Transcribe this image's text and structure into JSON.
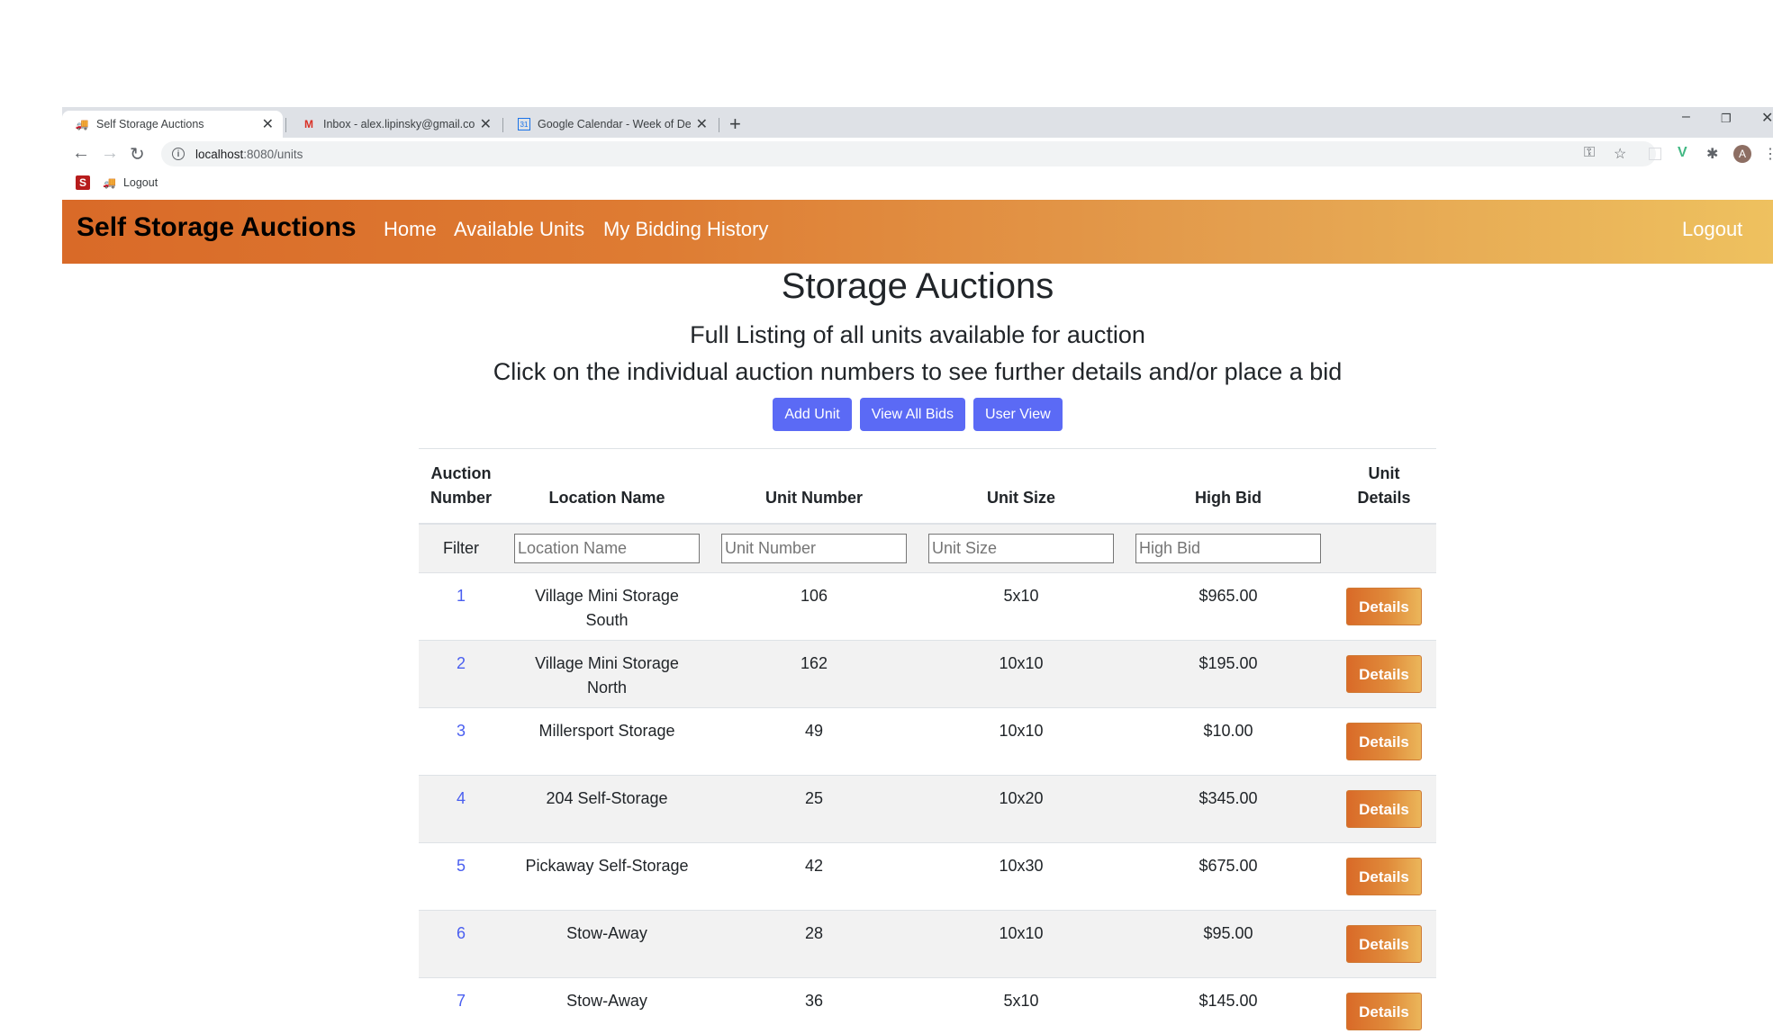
{
  "browser": {
    "tabs": [
      {
        "title": "Self Storage Auctions",
        "active": true
      },
      {
        "title": "Inbox - alex.lipinsky@gmail.com",
        "active": false
      },
      {
        "title": "Google Calendar - Week of Dece",
        "active": false
      }
    ],
    "url_host": "localhost",
    "url_path": ":8080/units",
    "bookmarks": [
      {
        "label": "Logout"
      }
    ],
    "avatar_letter": "A"
  },
  "navbar": {
    "brand": "Self Storage Auctions",
    "links": [
      "Home",
      "Available Units",
      "My Bidding History"
    ],
    "logout": "Logout"
  },
  "main": {
    "title": "Storage Auctions",
    "subtitle1": "Full Listing of all units available for auction",
    "subtitle2": "Click on the individual auction numbers to see further details and/or place a bid",
    "buttons": [
      "Add Unit",
      "View All Bids",
      "User View"
    ]
  },
  "table": {
    "headers": {
      "auction_1": "Auction",
      "auction_2": "Number",
      "location": "Location Name",
      "unit_number": "Unit Number",
      "unit_size": "Unit Size",
      "high_bid": "High Bid",
      "details_1": "Unit",
      "details_2": "Details"
    },
    "filter_label": "Filter",
    "filter_placeholders": {
      "location": "Location Name",
      "unit_number": "Unit Number",
      "unit_size": "Unit Size",
      "high_bid": "High Bid"
    },
    "details_label": "Details",
    "rows": [
      {
        "auction": "1",
        "location_1": "Village Mini Storage",
        "location_2": "South",
        "unit": "106",
        "size": "5x10",
        "bid": "$965.00"
      },
      {
        "auction": "2",
        "location_1": "Village Mini Storage",
        "location_2": "North",
        "unit": "162",
        "size": "10x10",
        "bid": "$195.00"
      },
      {
        "auction": "3",
        "location_1": "Millersport Storage",
        "location_2": "",
        "unit": "49",
        "size": "10x10",
        "bid": "$10.00"
      },
      {
        "auction": "4",
        "location_1": "204 Self-Storage",
        "location_2": "",
        "unit": "25",
        "size": "10x20",
        "bid": "$345.00"
      },
      {
        "auction": "5",
        "location_1": "Pickaway Self-Storage",
        "location_2": "",
        "unit": "42",
        "size": "10x30",
        "bid": "$675.00"
      },
      {
        "auction": "6",
        "location_1": "Stow-Away",
        "location_2": "",
        "unit": "28",
        "size": "10x10",
        "bid": "$95.00"
      },
      {
        "auction": "7",
        "location_1": "Stow-Away",
        "location_2": "",
        "unit": "36",
        "size": "5x10",
        "bid": "$145.00"
      }
    ]
  }
}
